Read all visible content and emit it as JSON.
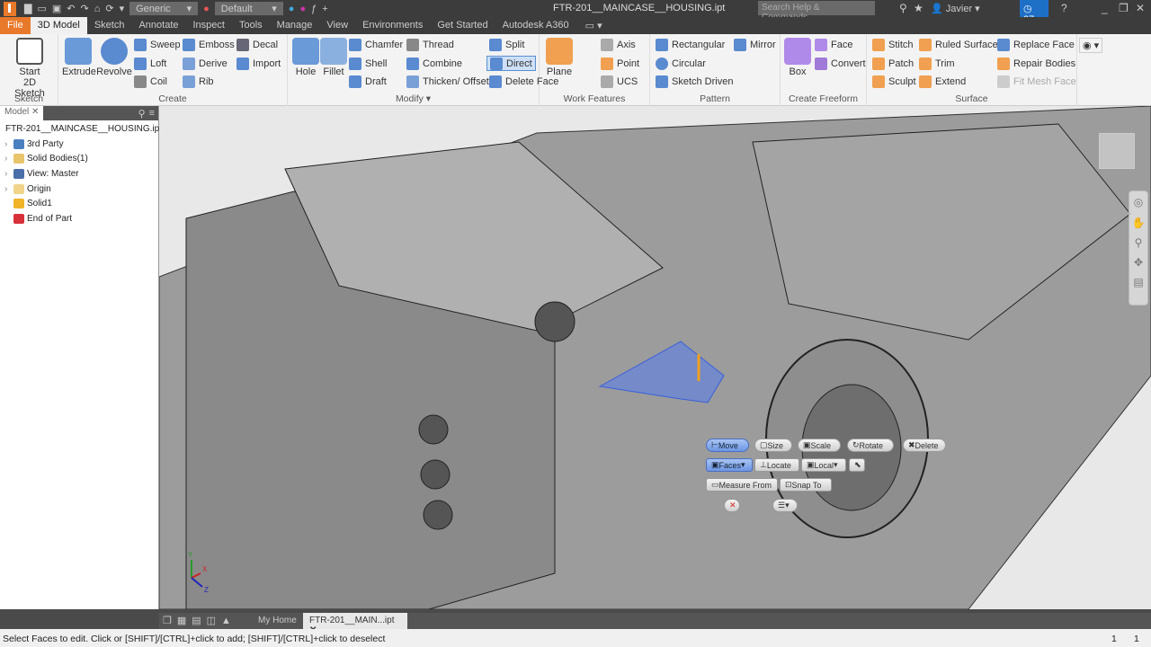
{
  "app": {
    "title": "FTR-201__MAINCASE__HOUSING.ipt",
    "search_placeholder": "Search Help & Commands...",
    "user": "Javier",
    "notifications": "27",
    "material": "Generic",
    "appearance": "Default"
  },
  "tabs": [
    "File",
    "3D Model",
    "Sketch",
    "Annotate",
    "Inspect",
    "Tools",
    "Manage",
    "View",
    "Environments",
    "Get Started",
    "Autodesk A360"
  ],
  "ribbon": {
    "sketch": {
      "label": "Sketch",
      "start": "Start",
      "start2": "2D Sketch"
    },
    "create": {
      "label": "Create",
      "extrude": "Extrude",
      "revolve": "Revolve",
      "sweep": "Sweep",
      "loft": "Loft",
      "coil": "Coil",
      "emboss": "Emboss",
      "derive": "Derive",
      "rib": "Rib",
      "decal": "Decal",
      "import": "Import"
    },
    "modify": {
      "label": "Modify ▾",
      "hole": "Hole",
      "fillet": "Fillet",
      "chamfer": "Chamfer",
      "shell": "Shell",
      "draft": "Draft",
      "thread": "Thread",
      "combine": "Combine",
      "thicken": "Thicken/ Offset",
      "split": "Split",
      "direct": "Direct",
      "delete_face": "Delete Face"
    },
    "work": {
      "label": "Work Features",
      "plane": "Plane",
      "axis": "Axis",
      "point": "Point",
      "ucs": "UCS"
    },
    "pattern": {
      "label": "Pattern",
      "rectangular": "Rectangular",
      "circular": "Circular",
      "sketch_driven": "Sketch Driven",
      "mirror": "Mirror"
    },
    "freeform": {
      "label": "Create Freeform",
      "box": "Box",
      "face": "Face",
      "convert": "Convert"
    },
    "surface": {
      "label": "Surface",
      "stitch": "Stitch",
      "patch": "Patch",
      "sculpt": "Sculpt",
      "ruled": "Ruled Surface",
      "trim": "Trim",
      "extend": "Extend",
      "replace": "Replace Face",
      "repair": "Repair Bodies",
      "fitmesh": "Fit Mesh Face"
    }
  },
  "browser": {
    "tab": "Model",
    "items": [
      {
        "label": "FTR-201__MAINCASE__HOUSING.ipt",
        "color": "#f0b429",
        "indent": 0,
        "expand": false
      },
      {
        "label": "3rd Party",
        "color": "#4a7fc0",
        "indent": 1,
        "expand": true
      },
      {
        "label": "Solid Bodies(1)",
        "color": "#e8c46a",
        "indent": 1,
        "expand": true
      },
      {
        "label": "View: Master",
        "color": "#4a6fa8",
        "indent": 1,
        "expand": true
      },
      {
        "label": "Origin",
        "color": "#f0d48a",
        "indent": 1,
        "expand": true
      },
      {
        "label": "Solid1",
        "color": "#f0b429",
        "indent": 1,
        "expand": false
      },
      {
        "label": "End of Part",
        "color": "#d8303a",
        "indent": 1,
        "expand": false
      }
    ]
  },
  "minitoolbar": {
    "move": "Move",
    "size": "Size",
    "scale": "Scale",
    "rotate": "Rotate",
    "delete": "Delete",
    "faces": "Faces",
    "locate": "Locate",
    "local": "Local",
    "measure_from": "Measure From",
    "snap_to": "Snap To"
  },
  "doctabs": {
    "home": "My Home",
    "doc": "FTR-201__MAIN...ipt"
  },
  "triad": {
    "x": "X",
    "y": "Y",
    "z": "Z"
  },
  "status": {
    "message": "Select Faces to edit. Click or [SHIFT]/[CTRL]+click to add; [SHIFT]/[CTRL]+click to deselect",
    "count1": "1",
    "count2": "1"
  },
  "colors": {
    "accent": "#e8782a",
    "selection": "#5a7fe8",
    "notify": "#1e6fc6"
  }
}
